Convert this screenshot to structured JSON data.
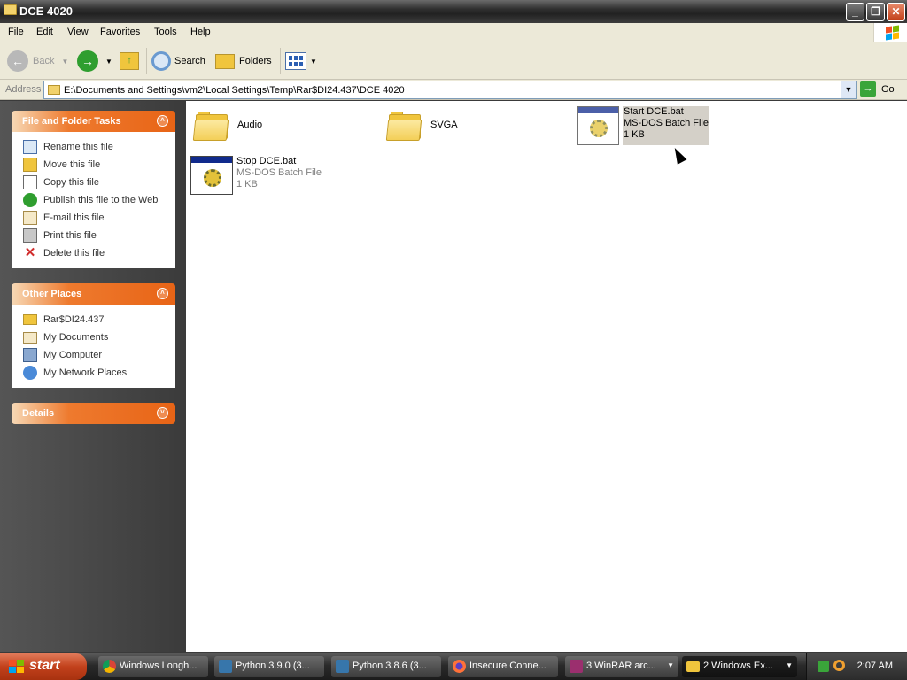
{
  "window": {
    "title": "DCE 4020",
    "minimize": "_",
    "maximize": "❐",
    "close": "✕"
  },
  "menu": [
    "File",
    "Edit",
    "View",
    "Favorites",
    "Tools",
    "Help"
  ],
  "toolbar": {
    "back": "Back",
    "search": "Search",
    "folders": "Folders"
  },
  "address": {
    "label": "Address",
    "path": "E:\\Documents and Settings\\vm2\\Local Settings\\Temp\\Rar$DI24.437\\DCE 4020",
    "go": "Go"
  },
  "tasks_panel": {
    "title": "File and Folder Tasks",
    "items": [
      {
        "label": "Rename this file",
        "icon": "rename-icon"
      },
      {
        "label": "Move this file",
        "icon": "move-icon"
      },
      {
        "label": "Copy this file",
        "icon": "copy-icon"
      },
      {
        "label": "Publish this file to the Web",
        "icon": "publish-web-icon"
      },
      {
        "label": "E-mail this file",
        "icon": "email-icon"
      },
      {
        "label": "Print this file",
        "icon": "printer-icon"
      },
      {
        "label": "Delete this file",
        "icon": "delete-x-icon"
      }
    ]
  },
  "places_panel": {
    "title": "Other Places",
    "items": [
      {
        "label": "Rar$DI24.437",
        "icon": "folder-icon"
      },
      {
        "label": "My Documents",
        "icon": "my-documents-icon"
      },
      {
        "label": "My Computer",
        "icon": "my-computer-icon"
      },
      {
        "label": "My Network Places",
        "icon": "network-places-icon"
      }
    ]
  },
  "details_panel": {
    "title": "Details"
  },
  "files": [
    {
      "name": "Audio",
      "type": "",
      "size": "",
      "icon": "folder-icon"
    },
    {
      "name": "SVGA",
      "type": "",
      "size": "",
      "icon": "folder-icon"
    },
    {
      "name": "Start DCE.bat",
      "type": "MS-DOS Batch File",
      "size": "1 KB",
      "icon": "batch-file-icon",
      "selected": true
    },
    {
      "name": "Stop DCE.bat",
      "type": "MS-DOS Batch File",
      "size": "1 KB",
      "icon": "batch-file-icon"
    }
  ],
  "taskbar": {
    "start": "start",
    "tasks": [
      {
        "label": "Windows Longh...",
        "icon": "chrome-icon"
      },
      {
        "label": "Python 3.9.0 (3...",
        "icon": "python-icon"
      },
      {
        "label": "Python 3.8.6 (3...",
        "icon": "python-icon"
      },
      {
        "label": "Insecure Conne...",
        "icon": "firefox-icon"
      },
      {
        "label": "3 WinRAR arc...",
        "icon": "winrar-icon"
      },
      {
        "label": "2 Windows Ex...",
        "icon": "folder-icon"
      }
    ],
    "clock": "2:07 AM"
  }
}
